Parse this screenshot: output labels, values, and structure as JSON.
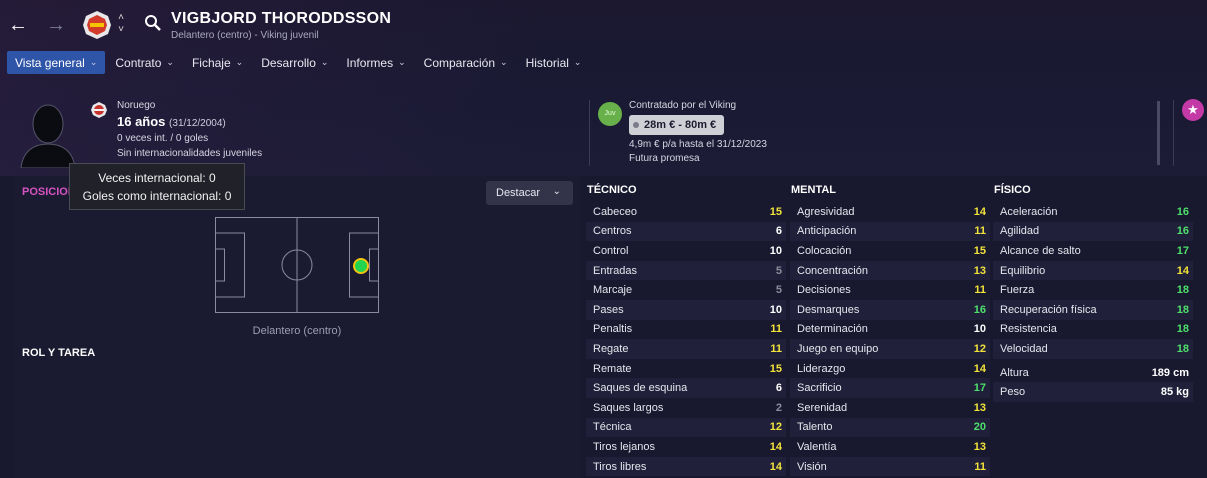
{
  "header": {
    "player_name": "VIGBJORD THORODDSSON",
    "player_subtitle": "Delantero (centro) - Viking juvenil"
  },
  "tabs": [
    {
      "label": "Vista general",
      "active": true
    },
    {
      "label": "Contrato"
    },
    {
      "label": "Fichaje"
    },
    {
      "label": "Desarrollo"
    },
    {
      "label": "Informes"
    },
    {
      "label": "Comparación"
    },
    {
      "label": "Historial"
    }
  ],
  "profile": {
    "nationality": "Noruego",
    "age": "16 años",
    "birthdate": "(31/12/2004)",
    "caps_goals": "0 veces int. / 0 goles",
    "youth_caps": "Sin internacionalidades juveniles"
  },
  "contract": {
    "badge": "Juv",
    "contracted_by": "Contratado por el Viking",
    "value": "28m € - 80m €",
    "wage": "4,9m € p/a hasta el 31/12/2023",
    "potential": "Futura promesa"
  },
  "tooltip": {
    "line1": "Veces internacional: 0",
    "line2": "Goles como internacional: 0"
  },
  "positions": {
    "title": "POSICIONES",
    "highlight_button": "Destacar",
    "pitch_label": "Delantero (centro)"
  },
  "role": {
    "title": "ROL Y TAREA"
  },
  "attributes": {
    "technical": {
      "title": "TÉCNICO",
      "items": [
        {
          "name": "Cabeceo",
          "value": "15"
        },
        {
          "name": "Centros",
          "value": "6"
        },
        {
          "name": "Control",
          "value": "10"
        },
        {
          "name": "Entradas",
          "value": "5"
        },
        {
          "name": "Marcaje",
          "value": "5"
        },
        {
          "name": "Pases",
          "value": "10"
        },
        {
          "name": "Penaltis",
          "value": "11"
        },
        {
          "name": "Regate",
          "value": "11"
        },
        {
          "name": "Remate",
          "value": "15"
        },
        {
          "name": "Saques de esquina",
          "value": "6"
        },
        {
          "name": "Saques largos",
          "value": "2"
        },
        {
          "name": "Técnica",
          "value": "12"
        },
        {
          "name": "Tiros lejanos",
          "value": "14"
        },
        {
          "name": "Tiros libres",
          "value": "14"
        }
      ]
    },
    "mental": {
      "title": "MENTAL",
      "items": [
        {
          "name": "Agresividad",
          "value": "14"
        },
        {
          "name": "Anticipación",
          "value": "11"
        },
        {
          "name": "Colocación",
          "value": "15"
        },
        {
          "name": "Concentración",
          "value": "13"
        },
        {
          "name": "Decisiones",
          "value": "11"
        },
        {
          "name": "Desmarques",
          "value": "16"
        },
        {
          "name": "Determinación",
          "value": "10"
        },
        {
          "name": "Juego en equipo",
          "value": "12"
        },
        {
          "name": "Liderazgo",
          "value": "14"
        },
        {
          "name": "Sacrificio",
          "value": "17"
        },
        {
          "name": "Serenidad",
          "value": "13"
        },
        {
          "name": "Talento",
          "value": "20"
        },
        {
          "name": "Valentía",
          "value": "13"
        },
        {
          "name": "Visión",
          "value": "11"
        }
      ]
    },
    "physical": {
      "title": "FÍSICO",
      "items": [
        {
          "name": "Aceleración",
          "value": "16"
        },
        {
          "name": "Agilidad",
          "value": "16"
        },
        {
          "name": "Alcance de salto",
          "value": "17"
        },
        {
          "name": "Equilibrio",
          "value": "14"
        },
        {
          "name": "Fuerza",
          "value": "18"
        },
        {
          "name": "Recuperación física",
          "value": "18"
        },
        {
          "name": "Resistencia",
          "value": "18"
        },
        {
          "name": "Velocidad",
          "value": "18"
        }
      ],
      "extra": [
        {
          "name": "Altura",
          "value": "189 cm"
        },
        {
          "name": "Peso",
          "value": "85 kg"
        }
      ]
    }
  },
  "colors": {
    "low": "#8c8c9c",
    "mid": "#ffffff",
    "good": "#f2e33a",
    "great": "#4ee06a",
    "accent": "#d654c2",
    "tab_active": "#2f55a8"
  }
}
